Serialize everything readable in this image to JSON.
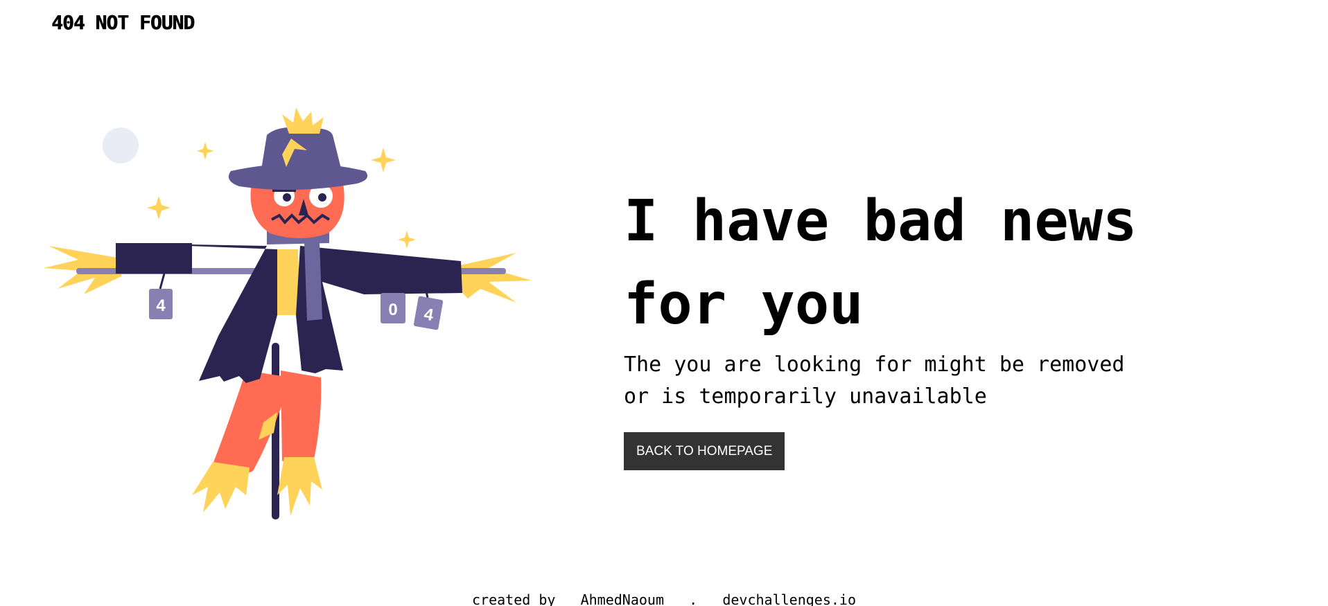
{
  "header": {
    "brand": "404 NOT FOUND"
  },
  "main": {
    "headline": "I have bad news for you",
    "message": "The you are looking for might be removed or is temporarily unavailable",
    "cta_label": "BACK TO HOMEPAGE"
  },
  "illustration": {
    "can_labels": [
      "4",
      "0",
      "4"
    ],
    "colors": {
      "hat": "#5e5790",
      "face": "#ff6b53",
      "coat": "#2b2350",
      "straw": "#ffd35a",
      "scarf": "#6e679e",
      "moon": "#e9ecf5",
      "can": "#8880b3"
    }
  },
  "footer": {
    "prefix": "created by",
    "author": "AhmedNaoum",
    "separator": ".",
    "site": "devchallenges.io"
  }
}
